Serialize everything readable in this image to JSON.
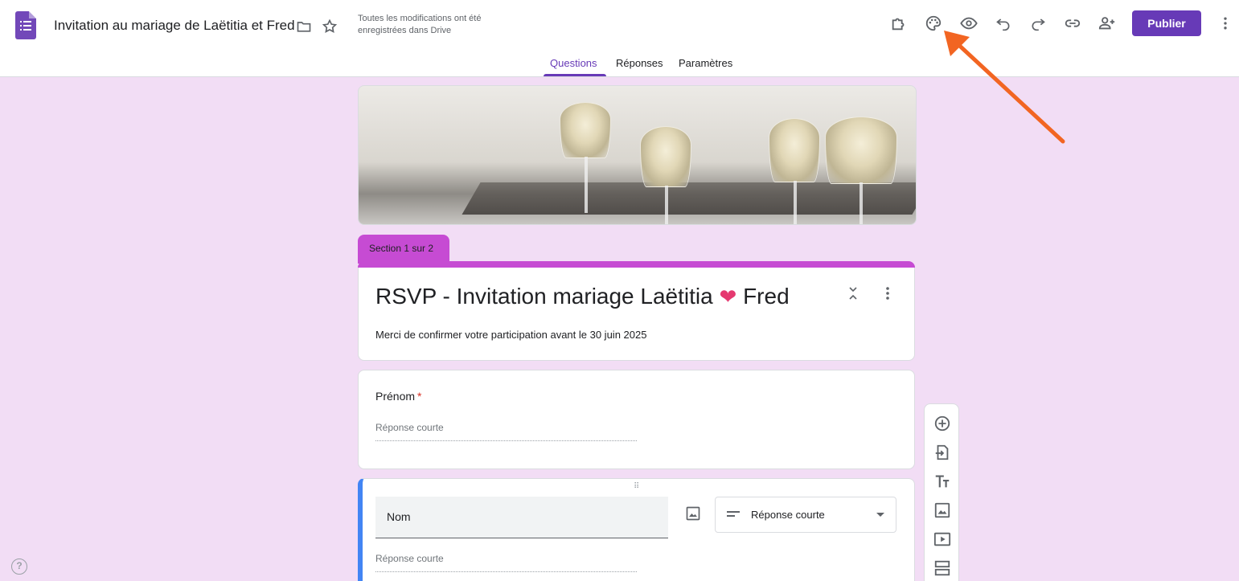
{
  "header": {
    "doc_title": "Invitation au mariage de Laëtitia et Fred",
    "save_status": "Toutes les modifications ont été enregistrées dans Drive",
    "publish_label": "Publier",
    "icons": [
      "forms-logo-icon",
      "folder-icon",
      "star-icon",
      "addon-puzzle-icon",
      "palette-icon",
      "preview-eye-icon",
      "undo-icon",
      "redo-icon",
      "link-icon",
      "add-collaborator-icon",
      "more-vert-icon"
    ]
  },
  "tabs": [
    {
      "label": "Questions",
      "active": true
    },
    {
      "label": "Réponses",
      "active": false
    },
    {
      "label": "Paramètres",
      "active": false
    }
  ],
  "section": {
    "label": "Section 1 sur 2",
    "title_before": "RSVP - Invitation mariage Laëtitia",
    "title_emoji": "❤",
    "title_after": "Fred",
    "description": "Merci de confirmer votre participation avant le 30 juin 2025"
  },
  "questions": [
    {
      "label": "Prénom",
      "required_mark": "*",
      "placeholder": "Réponse courte"
    },
    {
      "label": "Nom",
      "type": "Réponse courte",
      "placeholder": "Réponse courte",
      "drag_handle": "⠿"
    }
  ],
  "toolbar": [
    "add-question-icon",
    "import-questions-icon",
    "add-title-icon",
    "add-image-icon",
    "add-video-icon",
    "add-section-icon"
  ],
  "help_label": "?",
  "colors": {
    "accent": "#673ab7",
    "section": "#c64bd3",
    "background": "#f2ddf5",
    "arrow": "#f26522",
    "focus": "#4285f4"
  }
}
